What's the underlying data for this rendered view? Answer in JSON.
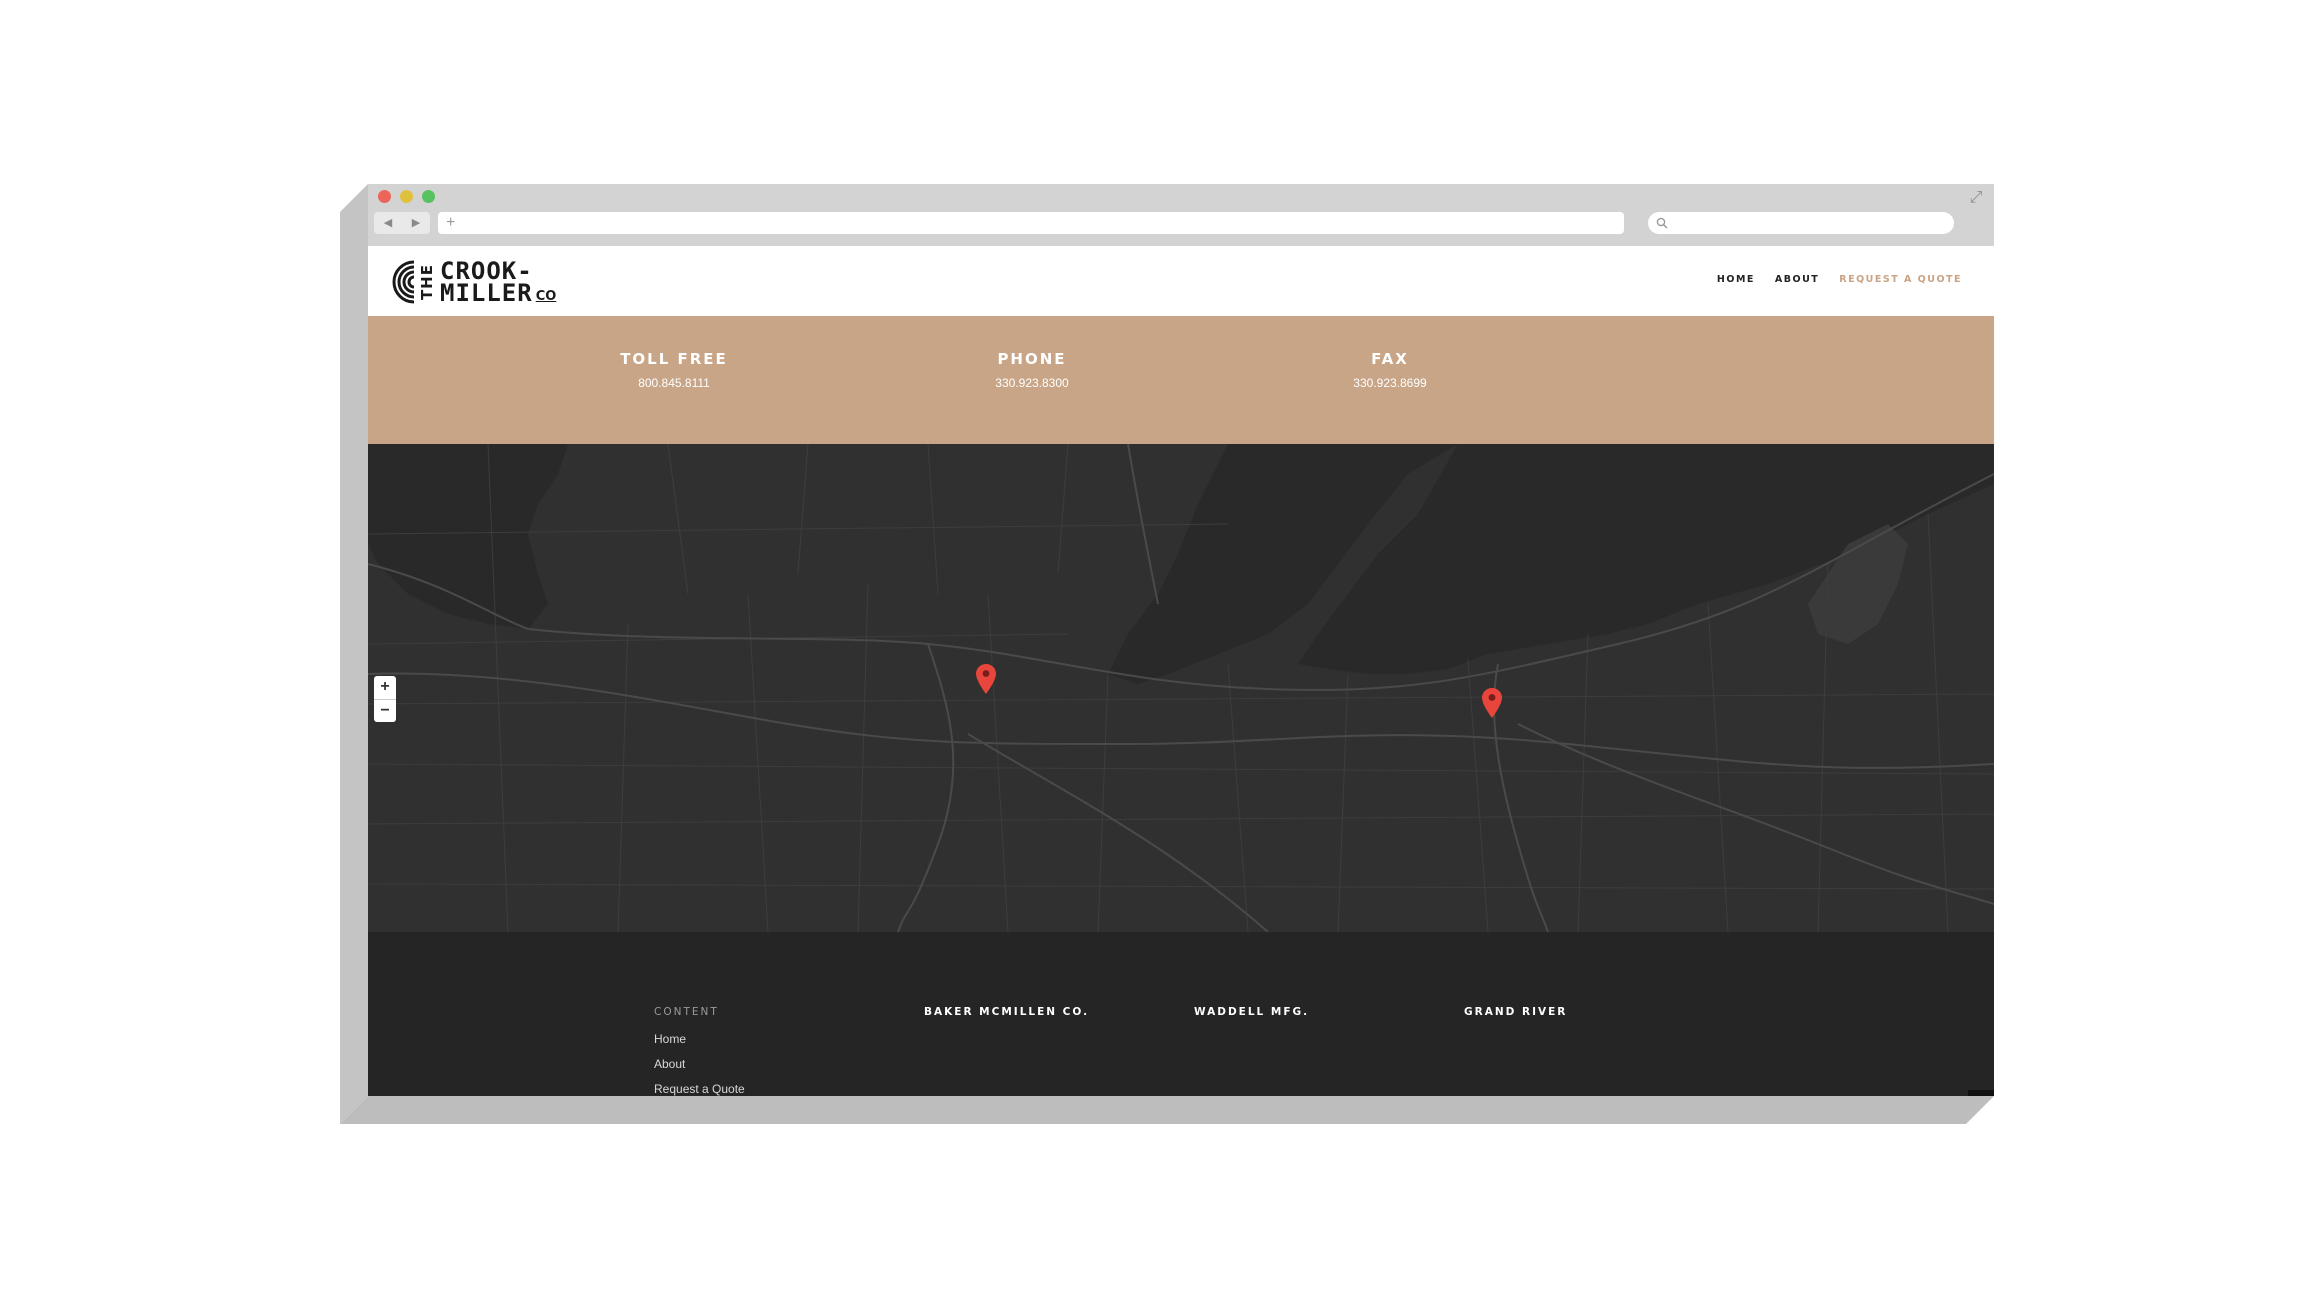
{
  "browser": {
    "nav_back": "◀",
    "nav_forward": "▶",
    "new_tab": "+",
    "expand_icon": "expand-icon"
  },
  "site": {
    "logo": {
      "the": "THE",
      "line1": "CROOK-",
      "line2": "MILLER",
      "co": "CO"
    },
    "menu": {
      "home": "HOME",
      "about": "ABOUT",
      "quote": "REQUEST A QUOTE"
    },
    "accent_color": "#c8a587"
  },
  "contact": {
    "toll_free": {
      "label": "TOLL FREE",
      "value": "800.845.8111"
    },
    "phone": {
      "label": "PHONE",
      "value": "330.923.8300"
    },
    "fax": {
      "label": "FAX",
      "value": "330.923.8699"
    }
  },
  "map": {
    "zoom_in": "+",
    "zoom_out": "−",
    "marker_color": "#e8453c"
  },
  "footer": {
    "content": {
      "heading": "CONTENT",
      "links": [
        "Home",
        "About",
        "Request a Quote"
      ]
    },
    "col2": {
      "heading": "BAKER MCMILLEN CO."
    },
    "col3": {
      "heading": "WADDELL MFG."
    },
    "col4": {
      "heading": "GRAND RIVER"
    }
  }
}
